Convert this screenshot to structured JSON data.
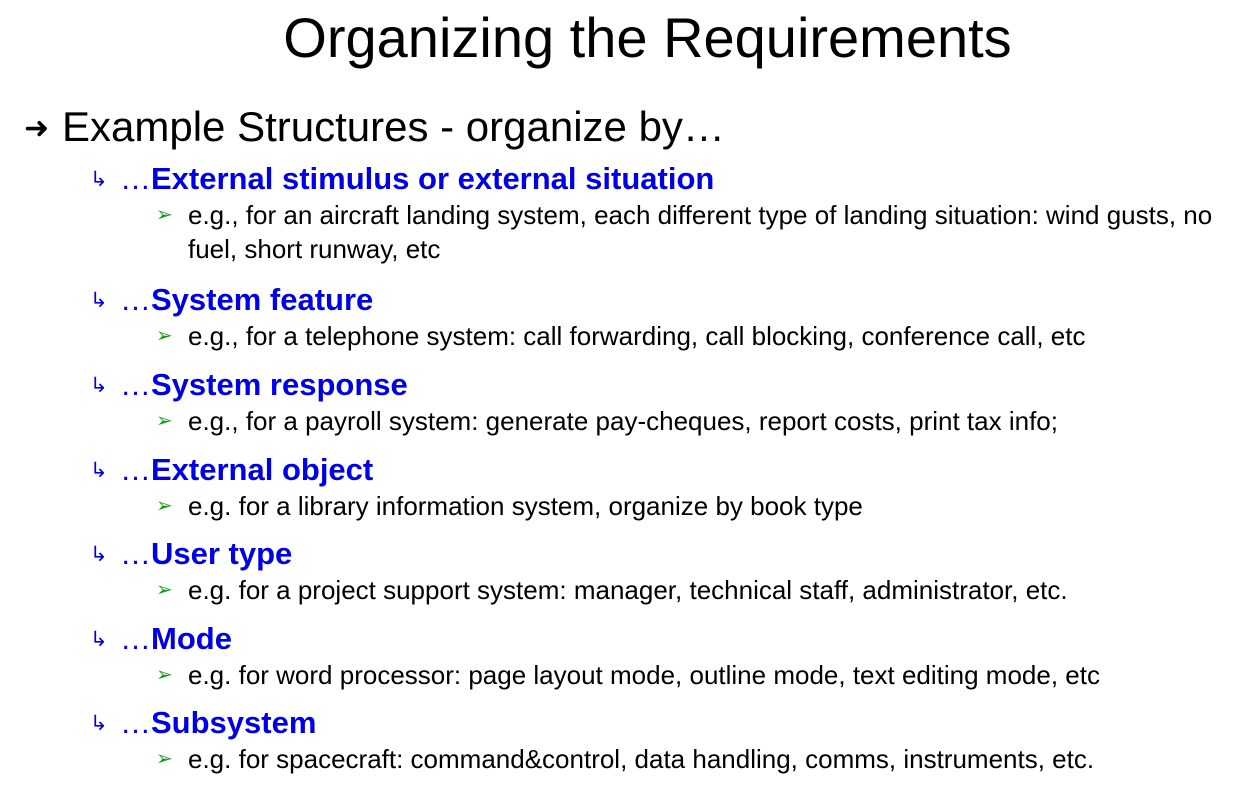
{
  "slide": {
    "title": "Organizing the Requirements",
    "main_bullet": "Example Structures - organize by…",
    "sub_bullet_prefix": "…",
    "items": [
      {
        "heading": "External stimulus or external situation",
        "example": "e.g., for an aircraft landing system, each different type of landing situation: wind gusts, no fuel, short runway, etc"
      },
      {
        "heading": "System feature",
        "example": "e.g., for a telephone system: call forwarding, call blocking, conference call, etc"
      },
      {
        "heading": "System response",
        "example": "e.g., for a payroll system: generate pay-cheques, report costs, print tax info;"
      },
      {
        "heading": "External object",
        "example": "e.g. for a library information system, organize by book type"
      },
      {
        "heading": "User type",
        "example": "e.g. for a project support system: manager, technical staff, administrator, etc."
      },
      {
        "heading": "Mode",
        "example": "e.g. for word processor: page layout mode, outline mode, text editing mode, etc"
      },
      {
        "heading": "Subsystem",
        "example": "e.g. for spacecraft: command&control, data handling, comms, instruments, etc."
      }
    ]
  },
  "icons": {
    "main_bullet": "right-arrow-icon",
    "sub_bullet": "hooked-arrow-icon",
    "example_bullet": "green-triangle-icon"
  },
  "colors": {
    "heading": "#0000e6",
    "example_bullet": "#1a9a1a",
    "text": "#000000"
  }
}
